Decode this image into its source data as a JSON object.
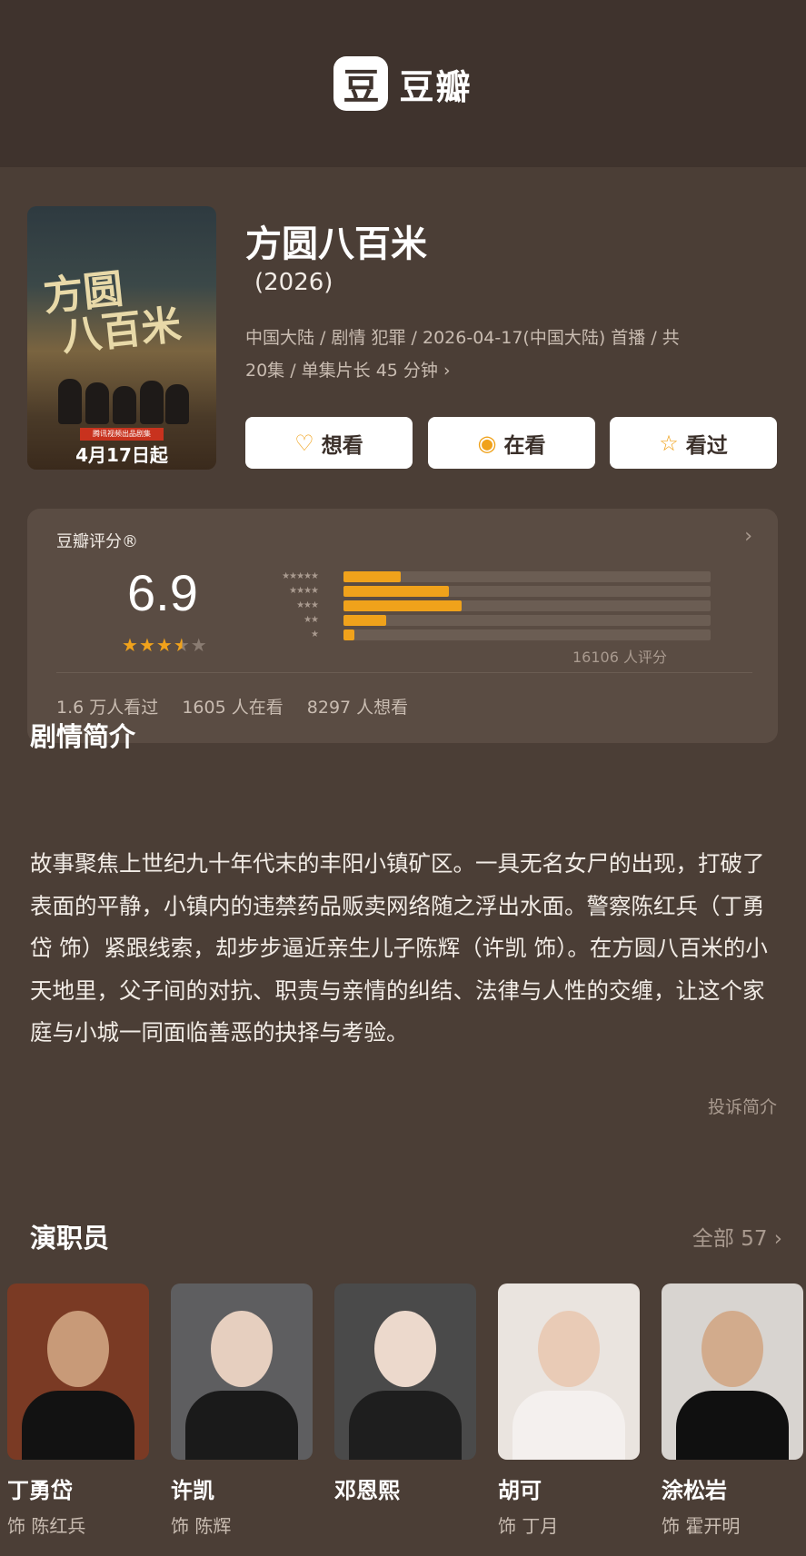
{
  "app": {
    "logo_char": "豆",
    "name": "豆瓣"
  },
  "poster": {
    "title_art": "方圆八百米",
    "badge": "腾讯视频出品剧集",
    "date": "4月17日起"
  },
  "movie": {
    "title": "方圆八百米",
    "year": "(2026)",
    "meta_line1": "中国大陆 / 剧情 犯罪 / 2026-04-17(中国大陆) 首播 / 共",
    "meta_line2": "20集 / 单集片长 45 分钟"
  },
  "actions": [
    {
      "label": "想看",
      "icon": "heart-plus-icon"
    },
    {
      "label": "在看",
      "icon": "target-icon"
    },
    {
      "label": "看过",
      "icon": "star-icon"
    }
  ],
  "rating": {
    "label": "豆瓣评分®",
    "score": "6.9",
    "stars_filled": 3.5,
    "count": "16106 人评分",
    "distribution": [
      {
        "stars": "★★★★★",
        "value": 0.157
      },
      {
        "stars": "★★★★",
        "value": 0.287
      },
      {
        "stars": "★★★",
        "value": 0.322
      },
      {
        "stars": "★★",
        "value": 0.117
      },
      {
        "stars": "★",
        "value": 0.03
      }
    ],
    "watched": "1.6 万人看过",
    "watching": "1605 人在看",
    "want": "8297 人想看"
  },
  "synopsis": {
    "title": "剧情简介",
    "text": "故事聚焦上世纪九十年代末的丰阳小镇矿区。一具无名女尸的出现，打破了表面的平静，小镇内的违禁药品贩卖网络随之浮出水面。警察陈红兵（丁勇岱 饰）紧跟线索，却步步逼近亲生儿子陈辉（许凯 饰）。在方圆八百米的小天地里，父子间的对抗、职责与亲情的纠结、法律与人性的交缠，让这个家庭与小城一同面临善恶的抉择与考验。",
    "report": "投诉简介"
  },
  "cast": {
    "title": "演职员",
    "all": "全部 57 ›",
    "members": [
      {
        "name": "丁勇岱",
        "role": "饰 陈红兵",
        "bg": "#7a3a24",
        "skin": "#c89a78",
        "cloth": "#121212"
      },
      {
        "name": "许凯",
        "role": "饰 陈辉",
        "bg": "#5e5e60",
        "skin": "#e6cfbf",
        "cloth": "#1a1a1a"
      },
      {
        "name": "邓恩熙",
        "role": "",
        "bg": "#4a4a4a",
        "skin": "#ecd9cc",
        "cloth": "#1e1e1e"
      },
      {
        "name": "胡可",
        "role": "饰 丁月",
        "bg": "#eae4df",
        "skin": "#e9cbb6",
        "cloth": "#f4f0ee"
      },
      {
        "name": "涂松岩",
        "role": "饰 霍开明",
        "bg": "#d8d4d0",
        "skin": "#d2ab8c",
        "cloth": "#101010"
      }
    ]
  }
}
